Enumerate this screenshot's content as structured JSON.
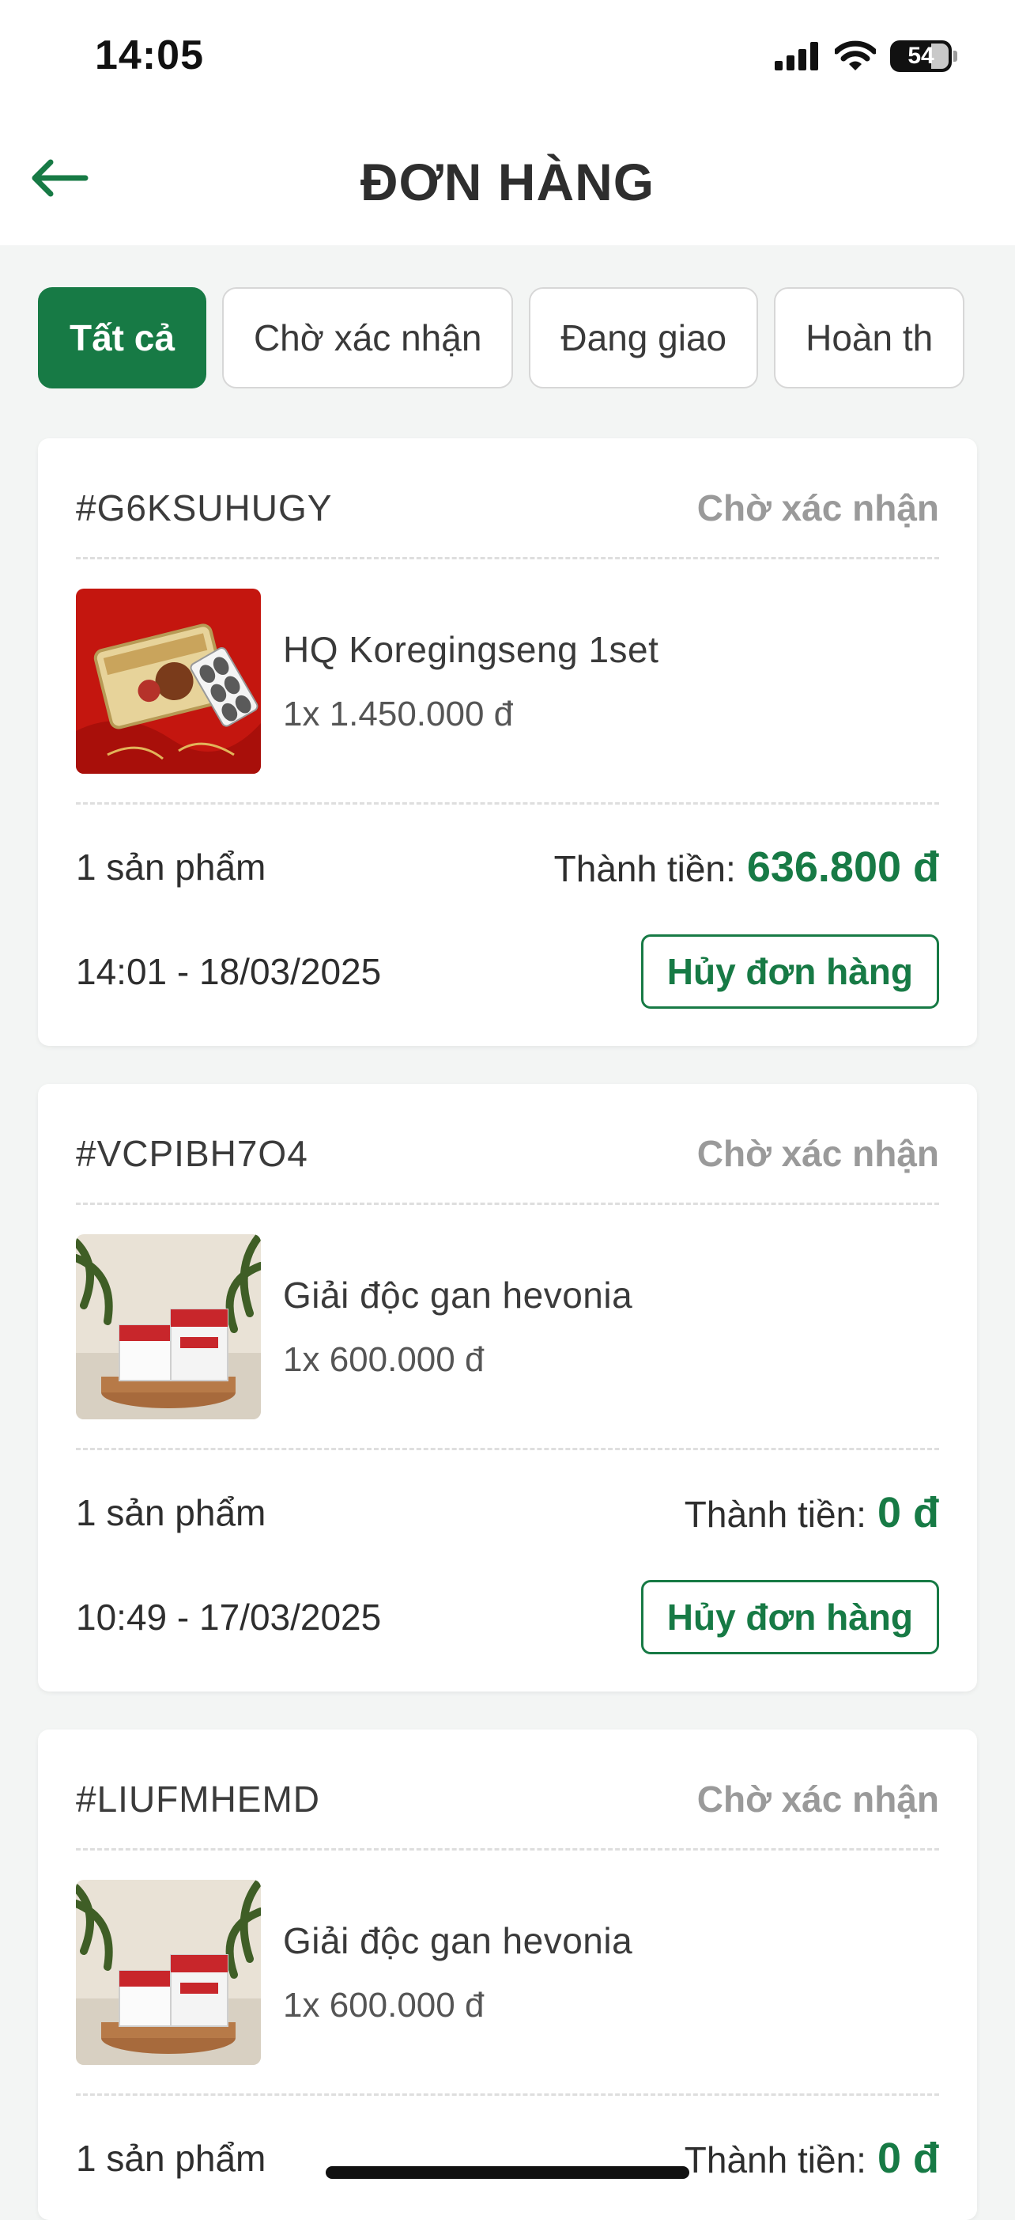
{
  "status_bar": {
    "time": "14:05",
    "battery": "54",
    "icons": [
      "signal-icon",
      "wifi-icon",
      "battery-icon"
    ]
  },
  "header": {
    "back_icon": "arrow-left-icon",
    "title": "ĐƠN HÀNG"
  },
  "tabs": [
    {
      "label": "Tất cả",
      "active": true
    },
    {
      "label": "Chờ xác nhận",
      "active": false
    },
    {
      "label": "Đang giao",
      "active": false
    },
    {
      "label": "Hoàn th",
      "active": false
    }
  ],
  "orders": [
    {
      "id": "#G6KSUHUGY",
      "status": "Chờ xác nhận",
      "product_name": "HQ Koregingseng 1set",
      "quantity_price": "1x 1.450.000 đ",
      "item_count": "1 sản phẩm",
      "total_label": "Thành tiền:",
      "total_value": "636.800 đ",
      "datetime": "14:01 - 18/03/2025",
      "cancel_label": "Hủy đơn hàng"
    },
    {
      "id": "#VCPIBH7O4",
      "status": "Chờ xác nhận",
      "product_name": "Giải độc gan hevonia",
      "quantity_price": "1x 600.000 đ",
      "item_count": "1 sản phẩm",
      "total_label": "Thành tiền:",
      "total_value": "0 đ",
      "datetime": "10:49 - 17/03/2025",
      "cancel_label": "Hủy đơn hàng"
    },
    {
      "id": "#LIUFMHEMD",
      "status": "Chờ xác nhận",
      "product_name": "Giải độc gan hevonia",
      "quantity_price": "1x 600.000 đ",
      "item_count": "1 sản phẩm",
      "total_label": "Thành tiền:",
      "total_value": "0 đ"
    }
  ],
  "colors": {
    "accent": "#177a45",
    "muted": "#9a9a9a",
    "background": "#f3f5f4"
  }
}
